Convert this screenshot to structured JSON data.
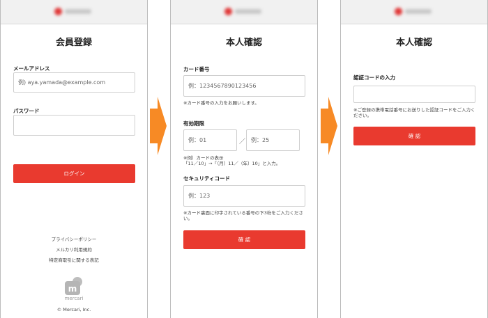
{
  "panel1": {
    "title": "会員登録",
    "email_label": "メールアドレス",
    "email_placeholder": "例) aya.yamada@example.com",
    "password_label": "パスワード",
    "password_placeholder": "",
    "login_button": "ログイン",
    "links": [
      "プライバシーポリシー",
      "メルカリ利用規約",
      "特定商取引に関する表記"
    ],
    "brand_name": "mercari",
    "copyright": "© Mercari, Inc."
  },
  "panel2": {
    "title": "本人確認",
    "card_number_label": "カード番号",
    "card_number_placeholder": "例：1234567890123456",
    "card_number_note": "※カード番号の入力をお願いします。",
    "expiry_label": "有効期限",
    "expiry_month_placeholder": "例：01",
    "expiry_separator": "／",
    "expiry_year_placeholder": "例：25",
    "expiry_note_line1": "※例）カードの表示",
    "expiry_note_line2": "「11／10」→「（月）11／（年）10」と入力。",
    "security_label": "セキュリティコード",
    "security_placeholder": "例：123",
    "security_note": "※カード裏面に印字されている番号の下3桁をご入力ください。",
    "confirm_button": "確 認"
  },
  "panel3": {
    "title": "本人確認",
    "code_label": "認証コードの入力",
    "code_placeholder": "",
    "code_note": "※ご登録の携帯電話番号にお送りした認証コードをご入力ください。",
    "confirm_button": "確 認"
  },
  "colors": {
    "accent": "#e93a2f",
    "arrow": "#f78a25"
  },
  "icons": [
    "flow-arrow-icon",
    "mercari-logo-icon"
  ]
}
